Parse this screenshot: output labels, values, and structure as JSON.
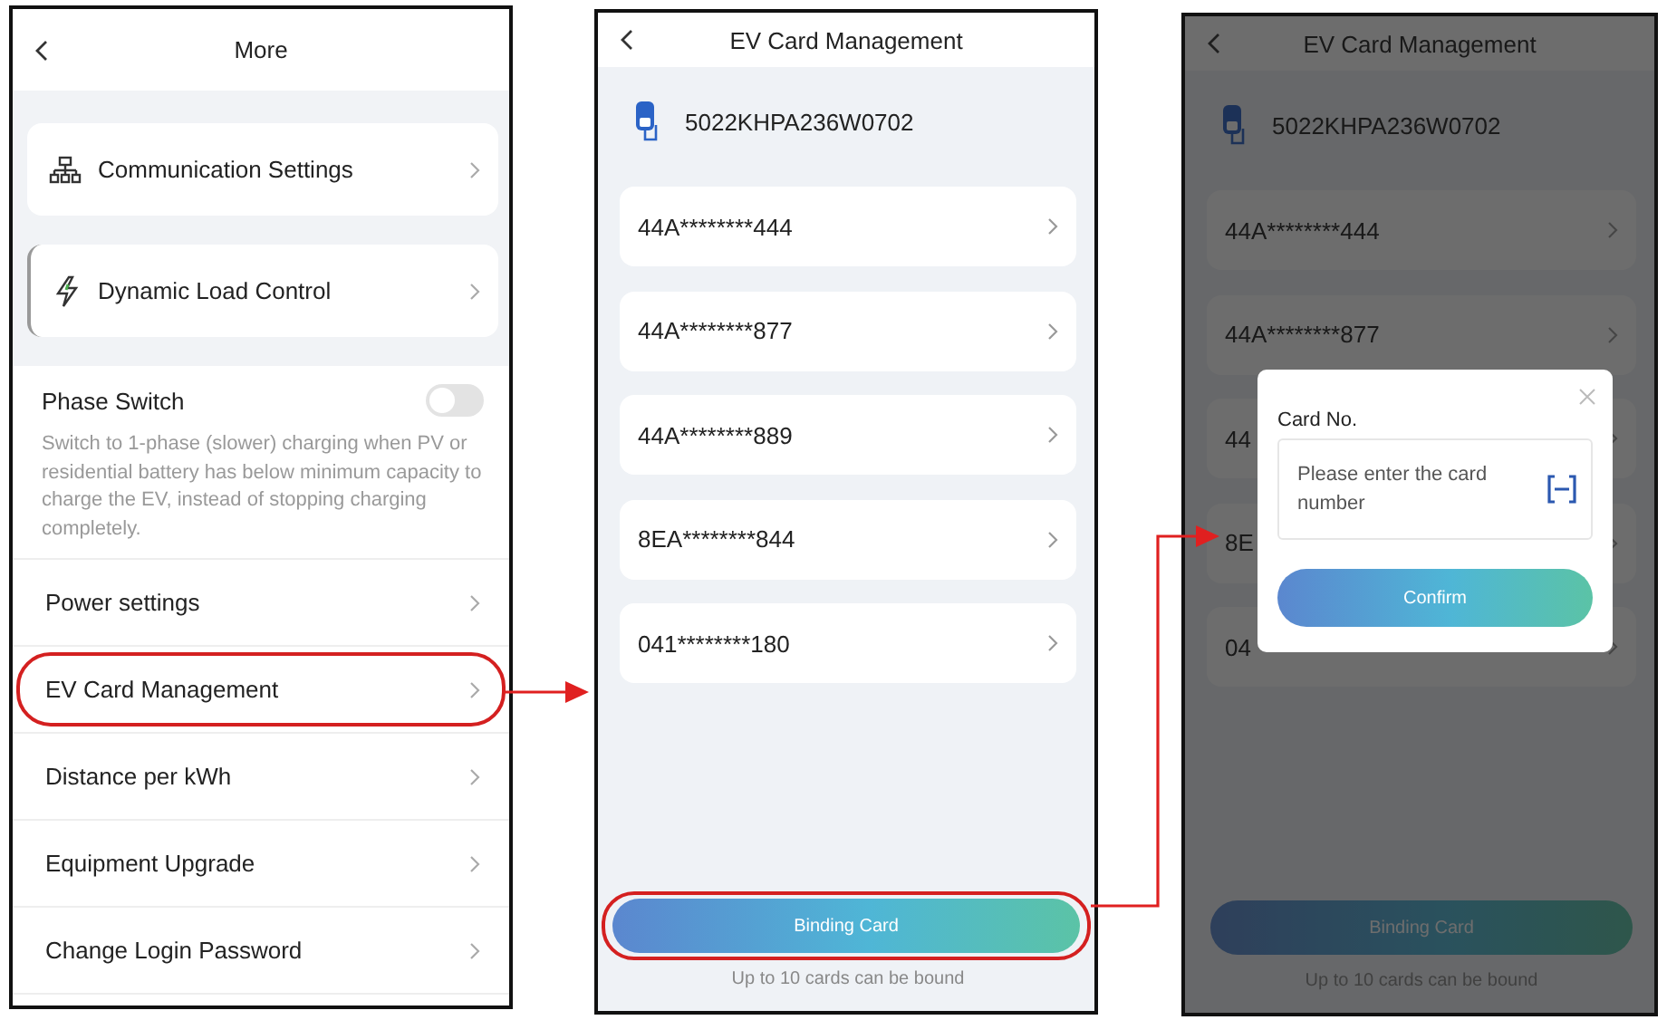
{
  "more_screen": {
    "title": "More",
    "cards": [
      {
        "label": "Communication Settings"
      },
      {
        "label": "Dynamic Load Control"
      }
    ],
    "phase_switch": {
      "label": "Phase Switch",
      "description": "Switch to 1-phase (slower) charging when PV or residential battery has below minimum capacity to charge the EV, instead of stopping charging completely.",
      "on": false
    },
    "menu_items": [
      {
        "label": "Power settings",
        "highlighted": false
      },
      {
        "label": "EV Card Management",
        "highlighted": true
      },
      {
        "label": "Distance per kWh",
        "highlighted": false
      },
      {
        "label": "Equipment Upgrade",
        "highlighted": false
      },
      {
        "label": "Change Login Password",
        "highlighted": false
      }
    ]
  },
  "cards_screen": {
    "title": "EV Card Management",
    "device_id": "5022KHPA236W0702",
    "cards": [
      "44A********444",
      "44A********877",
      "44A********889",
      "8EA********844",
      "041********180"
    ],
    "button": {
      "label": "Binding Card",
      "highlighted": true
    },
    "note": "Up to 10 cards can be bound"
  },
  "dialog_screen": {
    "title": "EV Card Management",
    "device_id": "5022KHPA236W0702",
    "cards": [
      "44A********444",
      "44A********877",
      "44",
      "8E",
      "04"
    ],
    "button": {
      "label": "Binding Card",
      "highlighted": false
    },
    "note": "Up to 10 cards can be bound",
    "dialog": {
      "label": "Card No.",
      "placeholder": "Please enter the card number",
      "confirm": "Confirm"
    }
  }
}
